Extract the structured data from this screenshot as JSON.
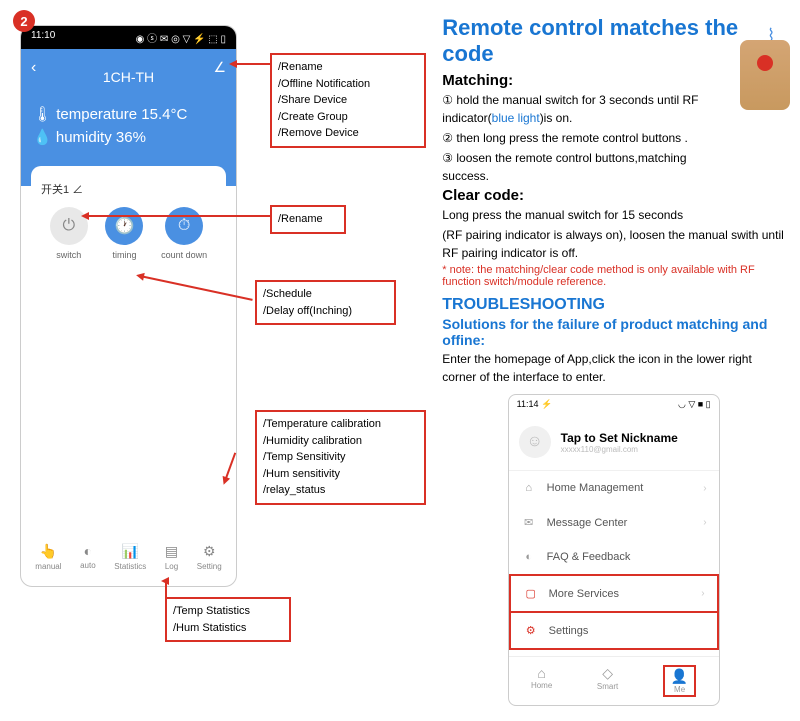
{
  "badge": "2",
  "phone": {
    "time": "11:10",
    "status_icons": "◉ ⓢ ✉ ◎ ▽ ⚡ ⬚ ▯",
    "title": "1CH-TH",
    "temperature_label": "temperature",
    "temperature_value": "15.4°C",
    "humidity_label": "humidity",
    "humidity_value": "36%",
    "panel_name": "开关1",
    "btns": {
      "switch": "switch",
      "timing": "timing",
      "countdown": "count down"
    },
    "tabs": {
      "manual": "manual",
      "auto": "auto",
      "statistics": "Statistics",
      "log": "Log",
      "setting": "Setting"
    }
  },
  "callouts": {
    "c1l1": "/Rename",
    "c1l2": "/Offline Notification",
    "c1l3": "/Share Device",
    "c1l4": "/Create Group",
    "c1l5": "/Remove Device",
    "c2": "/Rename",
    "c3l1": "/Schedule",
    "c3l2": "/Delay off(Inching)",
    "c4l1": "/Temperature calibration",
    "c4l2": "/Humidity calibration",
    "c4l3": "/Temp Sensitivity",
    "c4l4": "/Hum sensitivity",
    "c4l5": "/relay_status",
    "c5l1": "/Temp Statistics",
    "c5l2": "/Hum Statistics"
  },
  "right": {
    "title": "Remote control matches the code",
    "matching_h": "Matching:",
    "m1a": "① hold the manual switch for 3 seconds until RF indicator(",
    "m1b": "blue light",
    "m1c": ")is on.",
    "m2": "② then long press the remote control buttons .",
    "m3": "③ loosen the remote control buttons,matching success.",
    "clear_h": "Clear code:",
    "clear1": "Long press the manual switch for 15 seconds",
    "clear2": "(RF pairing indicator is always on), loosen the manual swith until RF pairing indicator is off.",
    "note": "* note: the matching/clear code method is only available with RF function switch/module reference.",
    "trouble_h": "TROUBLESHOOTING",
    "trouble_sub": "Solutions for the failure of product matching and offine:",
    "trouble_text": "Enter the homepage of App,click the icon in the lower right corner of the interface to enter."
  },
  "phone2": {
    "time": "11:14 ⚡",
    "icons": "◡ ▽ ■ ▯",
    "nickname": "Tap to Set Nickname",
    "email": "xxxxx110@gmail.com",
    "items": {
      "home": "Home Management",
      "msg": "Message Center",
      "faq": "FAQ & Feedback",
      "more": "More Services",
      "settings": "Settings"
    },
    "tabs": {
      "home": "Home",
      "smart": "Smart",
      "me": "Me"
    }
  }
}
